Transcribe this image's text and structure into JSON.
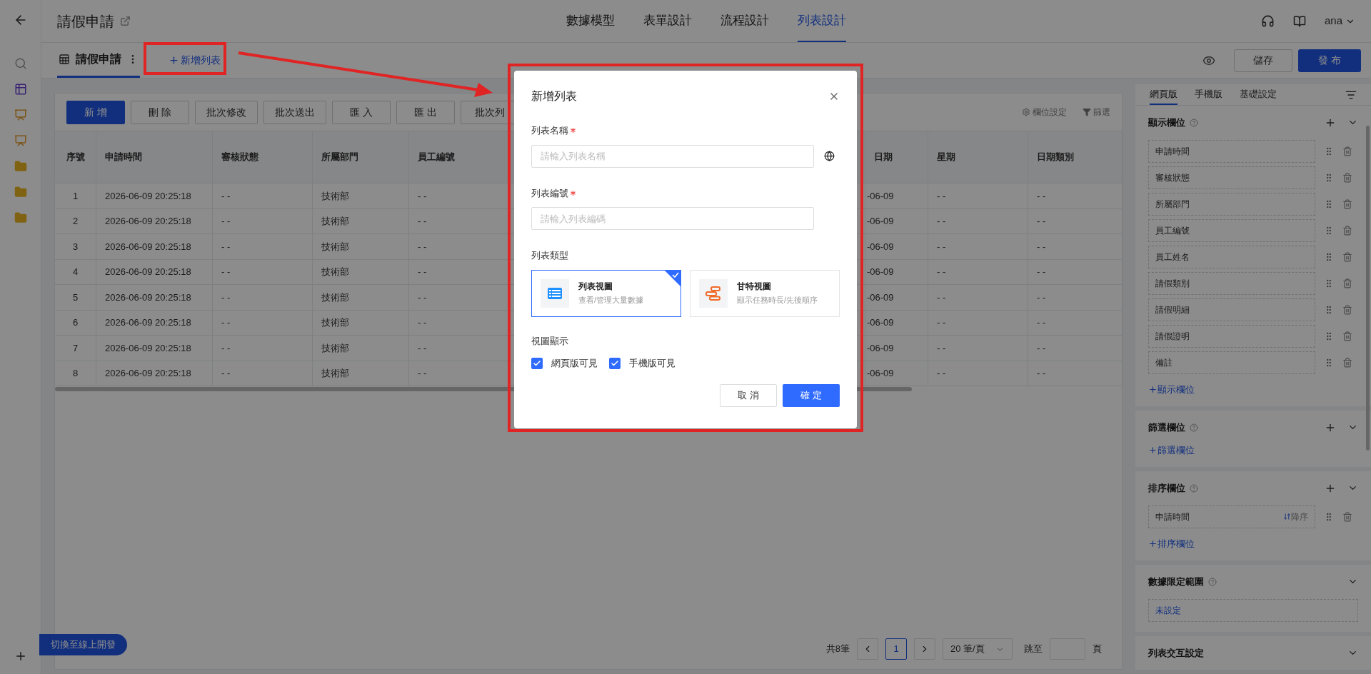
{
  "header": {
    "title": "請假申請",
    "nav_tabs": [
      {
        "label": "數據模型",
        "selected": false
      },
      {
        "label": "表單設計",
        "selected": false
      },
      {
        "label": "流程設計",
        "selected": false
      },
      {
        "label": "列表設計",
        "selected": true
      }
    ],
    "user": "ana"
  },
  "list_bar": {
    "tabs": [
      {
        "label": "請假申請",
        "selected": true
      }
    ],
    "add_link": "新增列表",
    "save": "儲存",
    "publish": "發 布"
  },
  "toolbar": {
    "buttons": [
      {
        "label": "新 增",
        "kind": "primary"
      },
      {
        "label": "刪 除",
        "kind": "default"
      },
      {
        "label": "批次修改",
        "kind": "default"
      },
      {
        "label": "批次送出",
        "kind": "default"
      },
      {
        "label": "匯 入",
        "kind": "default"
      },
      {
        "label": "匯 出",
        "kind": "default"
      },
      {
        "label": "批次列",
        "kind": "default"
      }
    ],
    "links": [
      {
        "label": "欄位設定",
        "kind": "settings"
      },
      {
        "label": "篩選",
        "kind": "filter"
      }
    ]
  },
  "table": {
    "columns": [
      "序號",
      "申請時間",
      "審核狀態",
      "所屬部門",
      "員工編號",
      "日期",
      "星期",
      "日期類別"
    ],
    "rows": [
      [
        "1",
        "2026-06-09 20:25:18",
        "- -",
        "技術部",
        "- -",
        "-06-09",
        "- -",
        "- -"
      ],
      [
        "2",
        "2026-06-09 20:25:18",
        "- -",
        "技術部",
        "- -",
        "-06-09",
        "- -",
        "- -"
      ],
      [
        "3",
        "2026-06-09 20:25:18",
        "- -",
        "技術部",
        "- -",
        "-06-09",
        "- -",
        "- -"
      ],
      [
        "4",
        "2026-06-09 20:25:18",
        "- -",
        "技術部",
        "- -",
        "-06-09",
        "- -",
        "- -"
      ],
      [
        "5",
        "2026-06-09 20:25:18",
        "- -",
        "技術部",
        "- -",
        "-06-09",
        "- -",
        "- -"
      ],
      [
        "6",
        "2026-06-09 20:25:18",
        "- -",
        "技術部",
        "- -",
        "-06-09",
        "- -",
        "- -"
      ],
      [
        "7",
        "2026-06-09 20:25:18",
        "- -",
        "技術部",
        "- -",
        "-06-09",
        "- -",
        "- -"
      ],
      [
        "8",
        "2026-06-09 20:25:18",
        "- -",
        "技術部",
        "- -",
        "-06-09",
        "- -",
        "- -"
      ]
    ]
  },
  "pagination": {
    "total": "共8筆",
    "pages": [
      {
        "label": "1",
        "selected": true
      }
    ],
    "page_size": "20 筆/頁",
    "jump_label": "跳至",
    "jump_suffix": "頁"
  },
  "switch_button": "切換至線上開發",
  "right_panel": {
    "tabs": [
      {
        "label": "網頁版",
        "selected": true
      },
      {
        "label": "手機版",
        "selected": false
      },
      {
        "label": "基礎設定",
        "selected": false
      }
    ],
    "sections": [
      {
        "title": "顯示欄位",
        "help": true,
        "add": true,
        "items": [
          {
            "label": "申請時間"
          },
          {
            "label": "審核狀態"
          },
          {
            "label": "所屬部門"
          },
          {
            "label": "員工編號"
          },
          {
            "label": "員工姓名"
          },
          {
            "label": "請假類別"
          },
          {
            "label": "請假明細"
          },
          {
            "label": "請假證明"
          },
          {
            "label": "備註"
          }
        ],
        "add_link": "顯示欄位"
      },
      {
        "title": "篩選欄位",
        "help": true,
        "add": true,
        "add_link": "篩選欄位"
      },
      {
        "title": "排序欄位",
        "help": true,
        "add": true,
        "items": [
          {
            "label": "申請時間",
            "order": "降序"
          }
        ],
        "add_link": "排序欄位"
      },
      {
        "title": "數據限定範圍",
        "help": true,
        "add": false,
        "value": "未設定"
      },
      {
        "title": "列表交互設定",
        "help": false,
        "add": false
      }
    ]
  },
  "dialog": {
    "title": "新增列表",
    "fields": [
      {
        "label": "列表名稱",
        "required": true,
        "placeholder": "請輸入列表名稱",
        "translate": true
      },
      {
        "label": "列表編號",
        "required": true,
        "placeholder": "請輸入列表編碼",
        "translate": false
      }
    ],
    "type_label": "列表類型",
    "types": [
      {
        "kind": "list",
        "title": "列表視圖",
        "description": "查看/管理大量數據",
        "selected": true
      },
      {
        "kind": "gantt",
        "title": "甘特視圖",
        "description": "顯示任務時長/先後順序",
        "selected": false
      }
    ],
    "visibility_label": "視圖顯示",
    "visibility": [
      {
        "label": "網頁版可見",
        "checked": true
      },
      {
        "label": "手機版可見",
        "checked": true
      }
    ],
    "cancel": "取 消",
    "confirm": "確 定"
  }
}
